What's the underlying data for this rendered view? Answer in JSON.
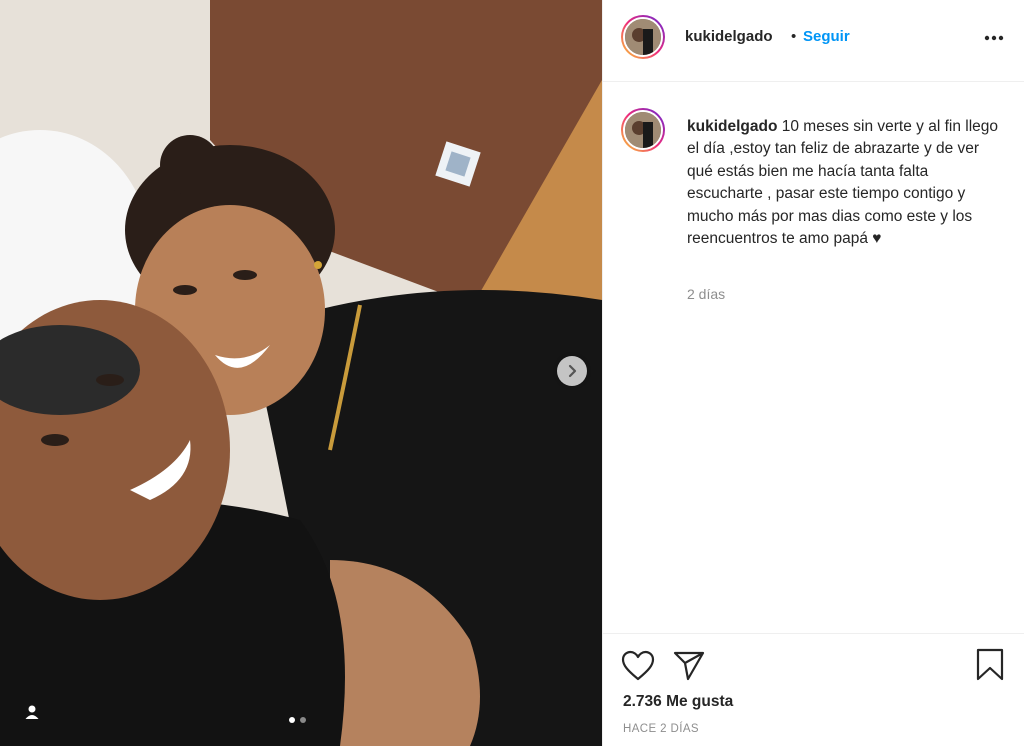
{
  "post": {
    "username": "kukidelgado",
    "bullet": "•",
    "follow_label": "Seguir",
    "more_icon": "more-options-icon",
    "caption_text": "10 meses sin verte y al fin llego el día ,estoy tan feliz de abrazarte y de ver qué estás bien me hacía tanta falta escucharte , pasar este tiempo contigo y mucho más por mas dias como este y los reencuentros te amo papá ♥",
    "caption_time": "2 días",
    "likes": "2.736 Me gusta",
    "date": "HACE 2 DÍAS"
  },
  "carousel": {
    "slide_count": 2,
    "active_slide": 1,
    "next_icon": "chevron-right-icon",
    "tag_icon": "user-tag-icon"
  },
  "colors": {
    "link": "#0095f6",
    "text": "#262626",
    "muted": "#8e8e8e",
    "border": "#efefef"
  }
}
